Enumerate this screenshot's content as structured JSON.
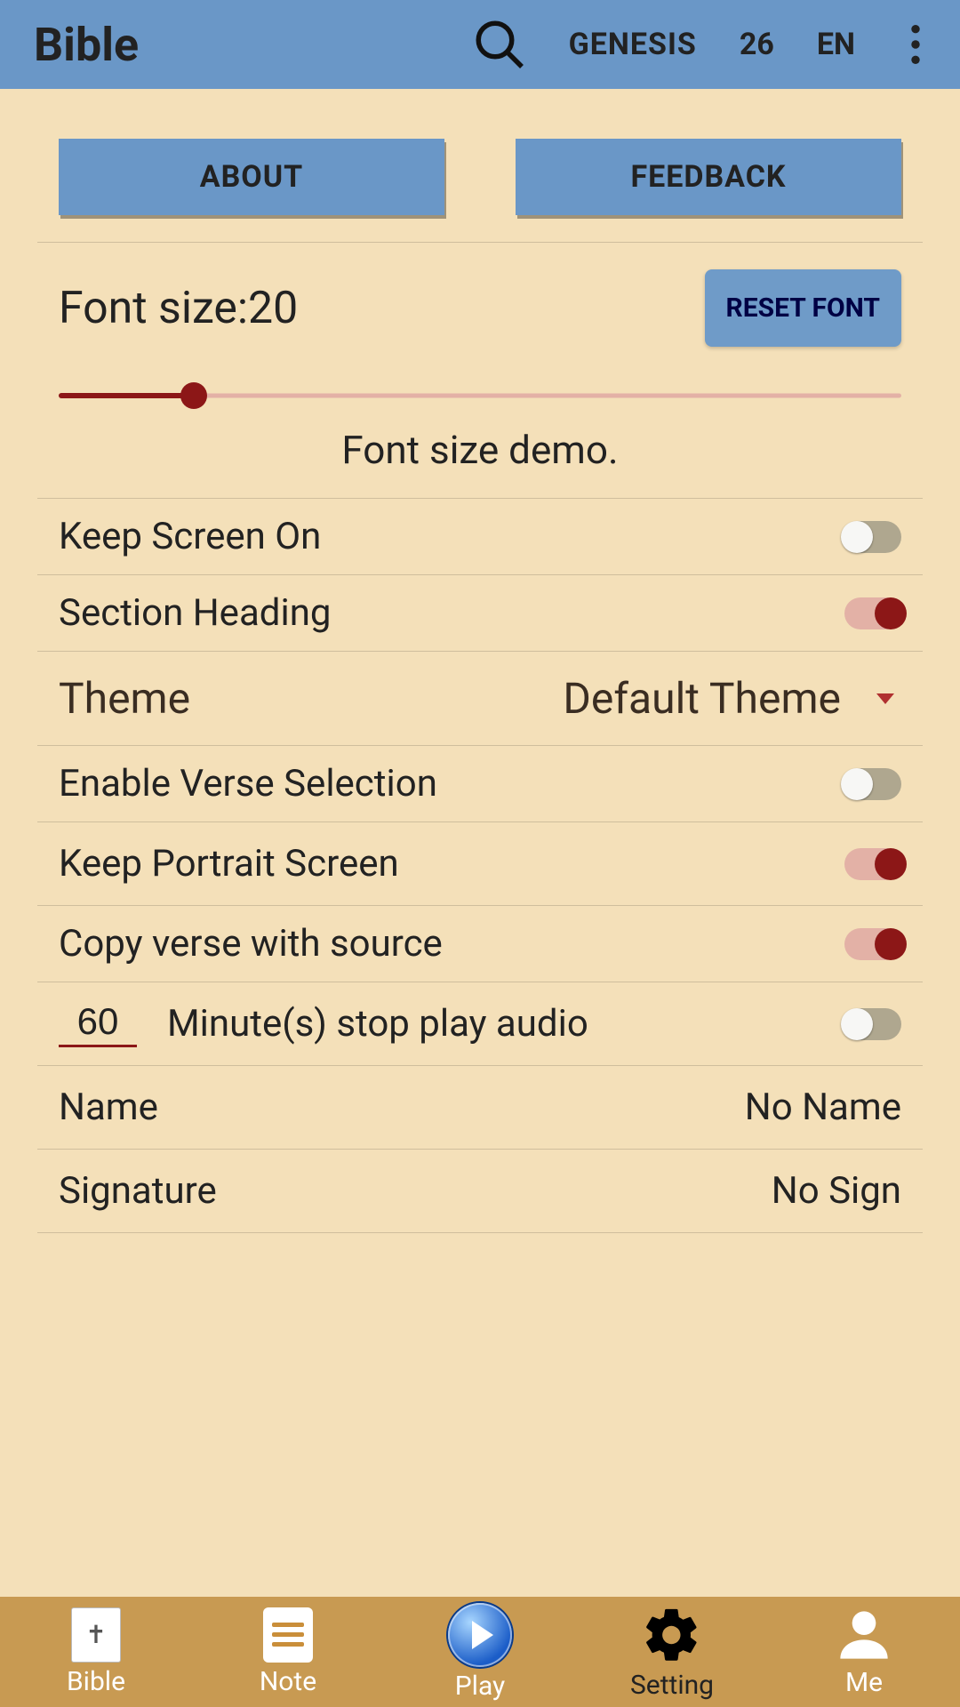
{
  "topbar": {
    "title": "Bible",
    "book": "GENESIS",
    "chapter": "26",
    "lang": "EN"
  },
  "buttons": {
    "about": "ABOUT",
    "feedback": "FEEDBACK",
    "reset_font": "RESET FONT"
  },
  "font": {
    "label": "Font size:20",
    "demo": "Font size demo."
  },
  "settings": {
    "keep_screen_on": "Keep Screen On",
    "section_heading": "Section Heading",
    "theme_label": "Theme",
    "theme_value": "Default Theme",
    "enable_verse_selection": "Enable Verse Selection",
    "keep_portrait": "Keep Portrait Screen",
    "copy_verse_source": "Copy verse with source",
    "minutes_value": "60",
    "minutes_label": "Minute(s) stop play audio",
    "name_label": "Name",
    "name_value": "No Name",
    "signature_label": "Signature",
    "signature_value": "No Sign"
  },
  "nav": {
    "bible": "Bible",
    "note": "Note",
    "play": "Play",
    "setting": "Setting",
    "me": "Me"
  }
}
